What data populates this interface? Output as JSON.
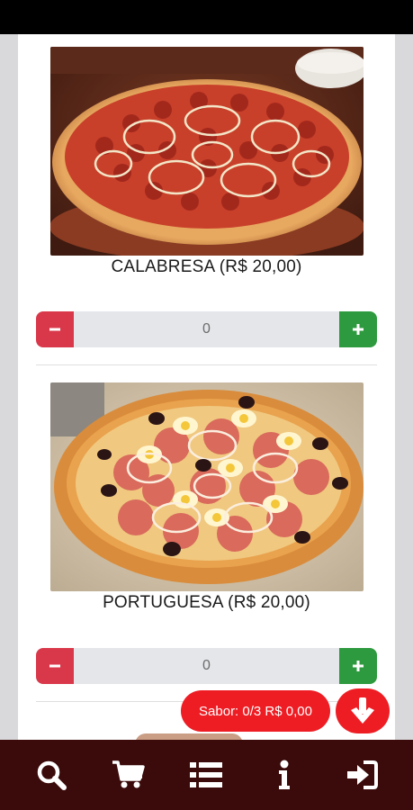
{
  "products": [
    {
      "name": "CALABRESA (R$ 20,00)",
      "quantity": "0"
    },
    {
      "name": "PORTUGUESA (R$ 20,00)",
      "quantity": "0"
    }
  ],
  "cart": {
    "summary": "Sabor: 0/3 R$ 0,00"
  },
  "nav": {
    "items": [
      "search-icon",
      "cart-icon",
      "list-icon",
      "info-icon",
      "sign-in-icon"
    ]
  },
  "colors": {
    "brand_red": "#ee1d24",
    "nav_background": "#3b0a0a",
    "minus_button": "#d9384a",
    "plus_button": "#2e9a3f"
  }
}
